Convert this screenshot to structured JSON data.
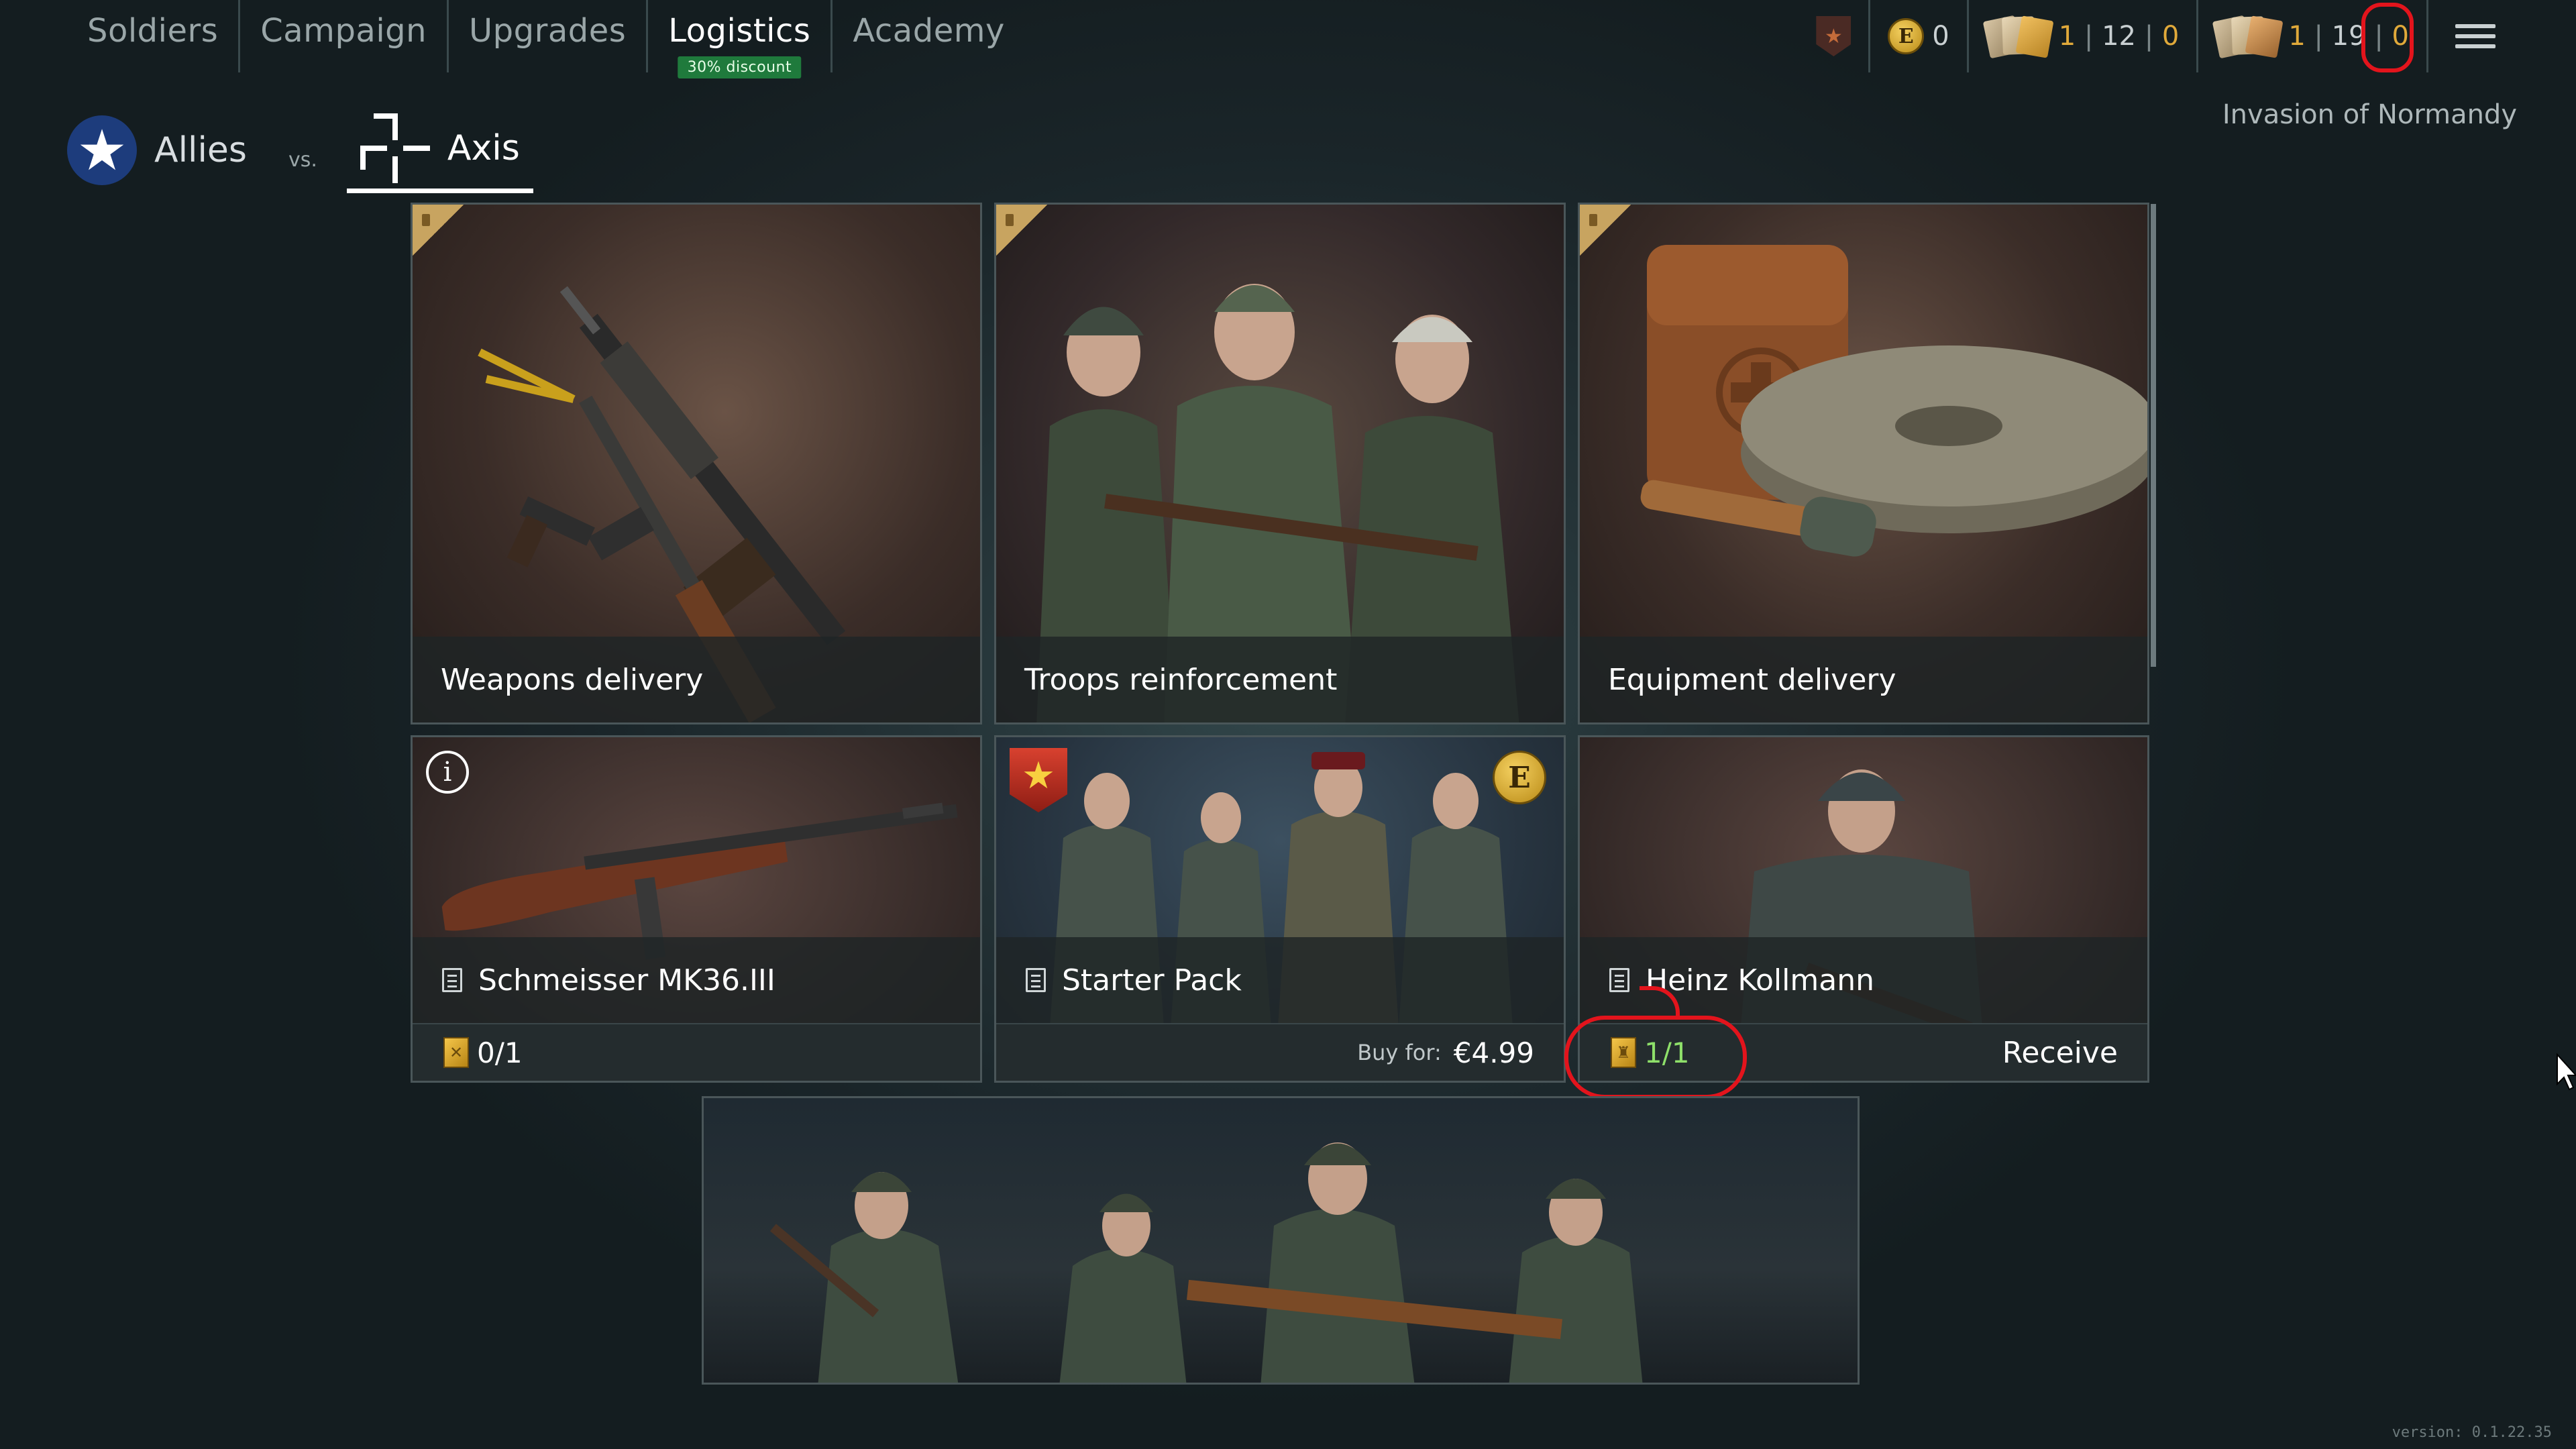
{
  "nav": {
    "tabs": [
      {
        "label": "Soldiers"
      },
      {
        "label": "Campaign"
      },
      {
        "label": "Upgrades"
      },
      {
        "label": "Logistics",
        "badge": "30% discount",
        "active": true
      },
      {
        "label": "Academy"
      }
    ]
  },
  "currencies": {
    "rank_icon": "rank-star-badge-icon",
    "eco_gold": "0",
    "weapon_tickets": {
      "a": "1",
      "b": "12",
      "c": "0"
    },
    "soldier_tickets": {
      "a": "1",
      "b": "19",
      "c": "0"
    }
  },
  "campaign": {
    "name": "Invasion of Normandy"
  },
  "factions": {
    "allies": "Allies",
    "vs": "vs.",
    "axis": "Axis",
    "selected": "Axis"
  },
  "cards": {
    "weapons": {
      "title": "Weapons delivery"
    },
    "troops": {
      "title": "Troops reinforcement"
    },
    "equipment": {
      "title": "Equipment delivery"
    },
    "schmeisser": {
      "title": "Schmeisser MK36.III",
      "progress": "0/1"
    },
    "starter": {
      "title": "Starter Pack",
      "buy_label": "Buy for:",
      "price": "€4.99"
    },
    "heinz": {
      "title": "Heinz Kollmann",
      "progress": "1/1",
      "action": "Receive"
    }
  },
  "version": "version: 0.1.22.35",
  "colors": {
    "accent_green": "#1f7a3c",
    "gold": "#e0a93a",
    "annotation_red": "#e3141c"
  }
}
